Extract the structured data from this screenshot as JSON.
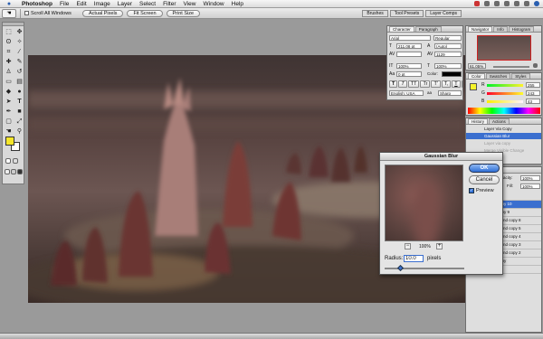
{
  "menubar": {
    "apple_icon": "apple-logo-icon",
    "items": [
      "Photoshop",
      "File",
      "Edit",
      "Image",
      "Layer",
      "Select",
      "Filter",
      "View",
      "Window",
      "Help"
    ]
  },
  "options_bar": {
    "scroll_all_windows": "Scroll All Windows",
    "actual_pixels": "Actual Pixels",
    "fit_screen": "Fit Screen",
    "print_size": "Print Size",
    "well_tabs": [
      "Brushes",
      "Tool Presets",
      "Layer Comps"
    ]
  },
  "tools": {
    "foreground_color": "#f5e62a",
    "background_color": "#ffffff",
    "icons": [
      "marquee-icon",
      "move-icon",
      "lasso-icon",
      "magic-wand-icon",
      "crop-icon",
      "slice-icon",
      "healing-icon",
      "brush-icon",
      "stamp-icon",
      "history-brush-icon",
      "eraser-icon",
      "gradient-icon",
      "blur-icon",
      "dodge-icon",
      "path-select-icon",
      "type-icon",
      "pen-icon",
      "shape-icon",
      "notes-icon",
      "eyedropper-icon",
      "hand-icon",
      "zoom-icon"
    ]
  },
  "character_panel": {
    "tabs": [
      "Character",
      "Paragraph"
    ],
    "font_family": "Arial",
    "font_style": "Regular",
    "font_size": "211.08 pt",
    "leading": "(Auto)",
    "kerning": "",
    "tracking": "1129",
    "vertical_scale": "100%",
    "horizontal_scale": "100%",
    "baseline": "0 pt",
    "color_label": "Color:",
    "style_buttons": [
      "T",
      "T",
      "TT",
      "Tr",
      "T'",
      "T,",
      "T",
      "T"
    ],
    "language": "English: USA",
    "anti_alias_label": "aa",
    "anti_alias": "Sharp"
  },
  "navigator": {
    "tabs": [
      "Navigator",
      "Info",
      "Histogram"
    ],
    "zoom": "61.05%"
  },
  "color_panel": {
    "tabs": [
      "Color",
      "Swatches",
      "Styles"
    ],
    "channels": [
      {
        "label": "R",
        "value": "255"
      },
      {
        "label": "G",
        "value": "243"
      },
      {
        "label": "B",
        "value": "43"
      }
    ],
    "swatch": "#f5f32b"
  },
  "history_panel": {
    "tabs": [
      "History",
      "Actions"
    ],
    "items": [
      "Layer Via Copy",
      "Gaussian Blur",
      "Layer via copy",
      "Merge Visible Change"
    ]
  },
  "layers_panel": {
    "opacity_label": "Opacity:",
    "opacity": "100%",
    "fill_label": "Fill:",
    "fill": "100%",
    "layers": [
      "Layer 4",
      "round copy 10",
      "round copy 9",
      "Background copy 8",
      "Background copy 5",
      "Background copy 4",
      "Background copy 3",
      "Background copy 2",
      "round copy",
      "ground"
    ]
  },
  "gaussian_blur_dialog": {
    "title": "Gaussian Blur",
    "ok": "OK",
    "cancel": "Cancel",
    "preview_label": "Preview",
    "preview_checked": true,
    "zoom": "100%",
    "zoom_out": "−",
    "zoom_in": "+",
    "radius_label": "Radius:",
    "radius_value": "10.0",
    "radius_unit": "pixels",
    "radius_slider_fraction": 0.2
  }
}
